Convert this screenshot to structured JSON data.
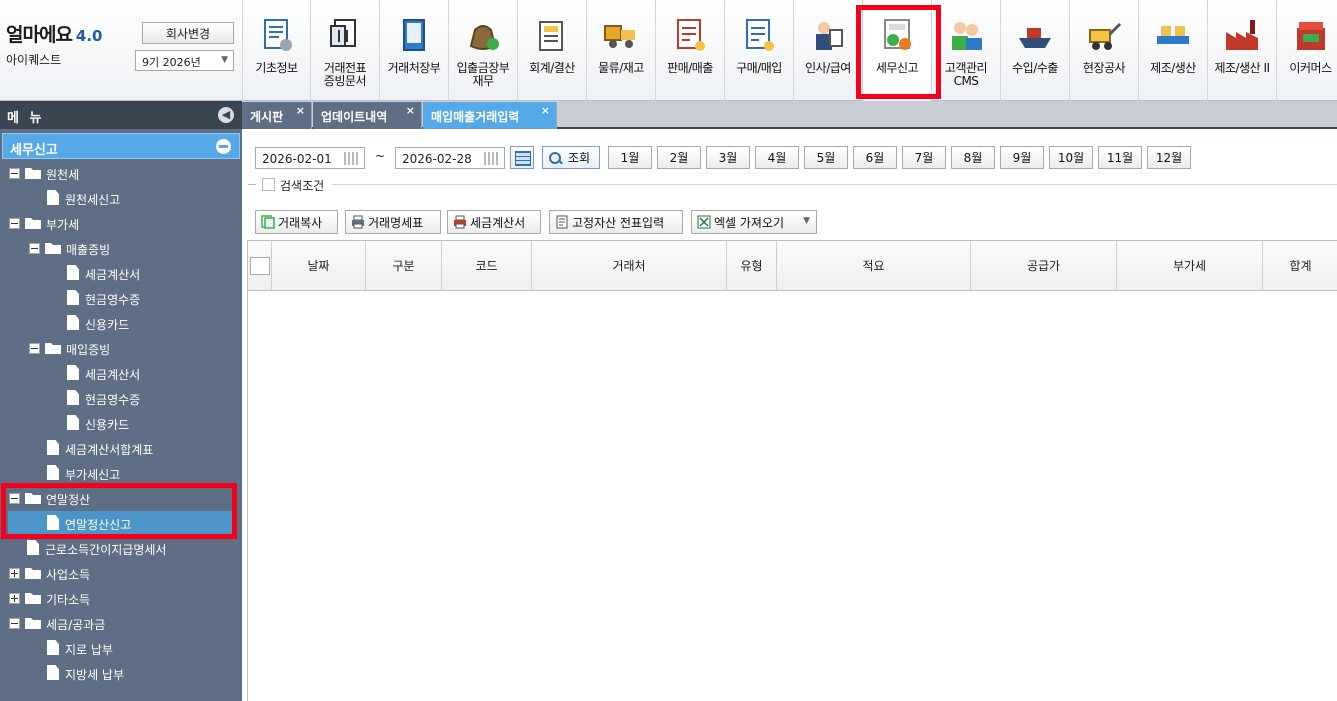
{
  "brand": {
    "logo": "얼마에요",
    "version": "4.0",
    "company": "아이퀘스트",
    "change_company": "회사변경",
    "period": "9기 2026년"
  },
  "modules": [
    {
      "label": "기초정보",
      "icon": "basic-info-icon"
    },
    {
      "label": "거래전표\n증빙문서",
      "icon": "voucher-icon"
    },
    {
      "label": "거래처장부",
      "icon": "ledger-book-icon"
    },
    {
      "label": "입출금장부\n재무",
      "icon": "money-bag-icon"
    },
    {
      "label": "회계/결산",
      "icon": "accounting-icon"
    },
    {
      "label": "물류/재고",
      "icon": "logistics-icon"
    },
    {
      "label": "판매/매출",
      "icon": "sales-icon"
    },
    {
      "label": "구매/매입",
      "icon": "purchase-icon"
    },
    {
      "label": "인사/급여",
      "icon": "hr-payroll-icon"
    },
    {
      "label": "세무신고",
      "icon": "tax-report-icon"
    },
    {
      "label": "고객관리\nCMS",
      "icon": "customer-cms-icon"
    },
    {
      "label": "수입/수출",
      "icon": "ship-icon"
    },
    {
      "label": "현장공사",
      "icon": "construction-icon"
    },
    {
      "label": "제조/생산",
      "icon": "manufacture-icon"
    },
    {
      "label": "제조/생산 II",
      "icon": "factory-icon"
    },
    {
      "label": "이커머스",
      "icon": "ecommerce-icon"
    }
  ],
  "sidebar": {
    "title": "메 뉴",
    "section": "세무신고",
    "tree": [
      {
        "label": "원천세",
        "type": "folder",
        "level": 0,
        "toggle": "minus"
      },
      {
        "label": "원천세신고",
        "type": "doc",
        "level": 1
      },
      {
        "label": "부가세",
        "type": "folder",
        "level": 0,
        "toggle": "minus"
      },
      {
        "label": "매출증빙",
        "type": "folder",
        "level": 1,
        "toggle": "minus"
      },
      {
        "label": "세금계산서",
        "type": "doc",
        "level": 2
      },
      {
        "label": "현금영수증",
        "type": "doc",
        "level": 2
      },
      {
        "label": "신용카드",
        "type": "doc",
        "level": 2
      },
      {
        "label": "매입증빙",
        "type": "folder",
        "level": 1,
        "toggle": "minus"
      },
      {
        "label": "세금계산서",
        "type": "doc",
        "level": 2
      },
      {
        "label": "현금영수증",
        "type": "doc",
        "level": 2
      },
      {
        "label": "신용카드",
        "type": "doc",
        "level": 2
      },
      {
        "label": "세금계산서합계표",
        "type": "doc",
        "level": 1
      },
      {
        "label": "부가세신고",
        "type": "doc",
        "level": 1
      },
      {
        "label": "연말정산",
        "type": "folder",
        "level": 0,
        "toggle": "minus"
      },
      {
        "label": "연말정산신고",
        "type": "doc",
        "level": 1,
        "selected": true
      },
      {
        "label": "근로소득간이지급명세서",
        "type": "doc",
        "level": 0.5
      },
      {
        "label": "사업소득",
        "type": "folder",
        "level": 0,
        "toggle": "plus"
      },
      {
        "label": "기타소득",
        "type": "folder",
        "level": 0,
        "toggle": "plus"
      },
      {
        "label": "세금/공과금",
        "type": "folder",
        "level": 0,
        "toggle": "minus"
      },
      {
        "label": "지로 납부",
        "type": "doc",
        "level": 1
      },
      {
        "label": "지방세 납부",
        "type": "doc",
        "level": 1
      }
    ]
  },
  "tabs": [
    {
      "label": "게시판",
      "active": false
    },
    {
      "label": "업데이트내역",
      "active": false
    },
    {
      "label": "매입매출거래입력",
      "active": true
    }
  ],
  "tab_close": "×",
  "filter": {
    "date_from": "2026-02-01",
    "date_to": "2026-02-28",
    "tilde": "~",
    "search": "조회",
    "months": [
      "1월",
      "2월",
      "3월",
      "4월",
      "5월",
      "6월",
      "7월",
      "8월",
      "9월",
      "10월",
      "11월",
      "12월"
    ],
    "condition": "검색조건"
  },
  "actions": [
    {
      "label": "거래복사",
      "icon": "copy-icon"
    },
    {
      "label": "거래명세표",
      "icon": "printer-icon"
    },
    {
      "label": "세금계산서",
      "icon": "printer-red-icon"
    },
    {
      "label": "고정자산 전표입력",
      "icon": "document-icon"
    },
    {
      "label": "엑셀 가져오기",
      "icon": "excel-icon"
    }
  ],
  "grid": {
    "columns": [
      "날짜",
      "구분",
      "코드",
      "거래처",
      "유형",
      "적요",
      "공급가",
      "부가세",
      "합계"
    ]
  },
  "colors": {
    "sidebar": "#5e6f85",
    "section": "#56a9e8",
    "highlight": "#f5001a"
  }
}
